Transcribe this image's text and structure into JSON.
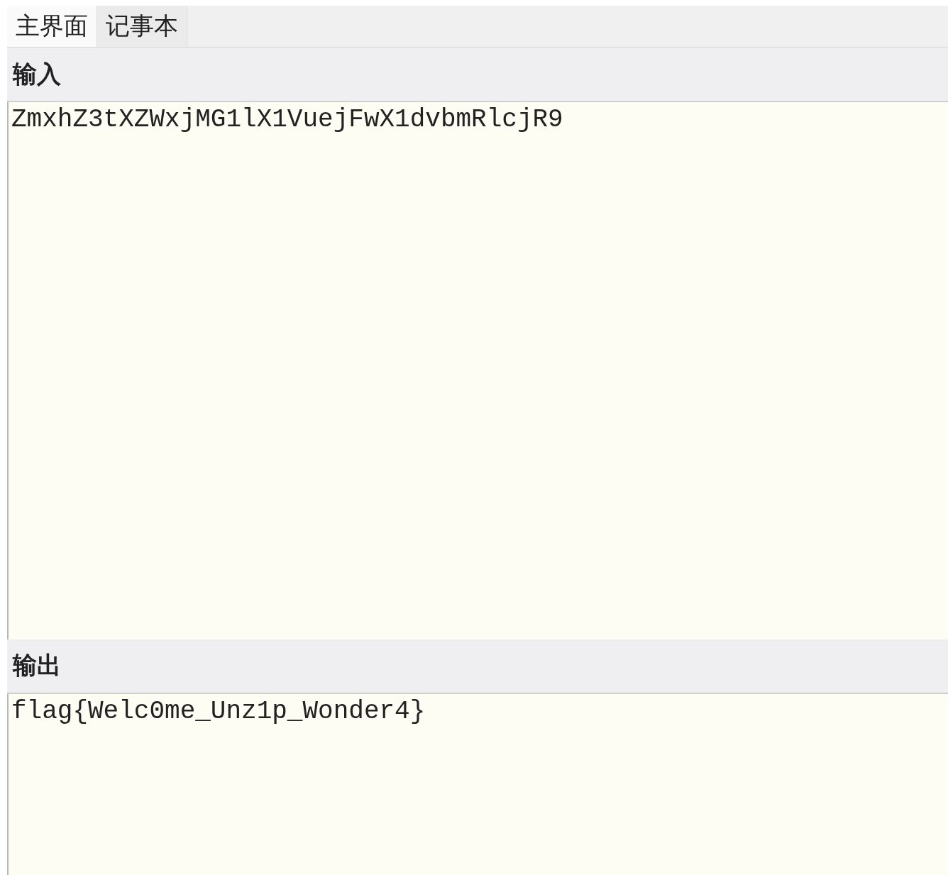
{
  "tabs": [
    {
      "label": "主界面",
      "selected": true
    },
    {
      "label": "记事本",
      "selected": false
    }
  ],
  "input": {
    "label": "输入",
    "value": "ZmxhZ3tXZWxjMG1lX1VuejFwX1dvbmRlcjR9"
  },
  "output": {
    "label": "输出",
    "value": "flag{Welc0me_Unz1p_Wonder4}"
  }
}
